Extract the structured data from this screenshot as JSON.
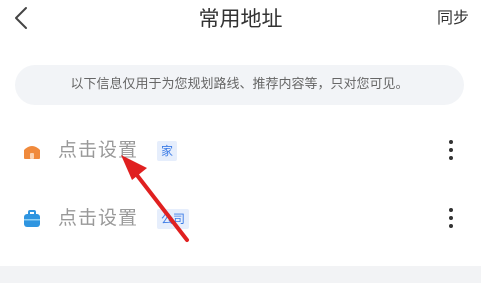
{
  "header": {
    "back_icon": "chevron-left",
    "title": "常用地址",
    "sync_label": "同步"
  },
  "notice": {
    "text": "以下信息仅用于为您规划路线、推荐内容等，只对您可见。"
  },
  "addresses": [
    {
      "icon": "home-icon",
      "icon_color": "#f08a3c",
      "label": "点击设置",
      "tag": "家",
      "more_icon": "more-vertical"
    },
    {
      "icon": "briefcase-icon",
      "icon_color": "#2f95e0",
      "label": "点击设置",
      "tag": "公司",
      "more_icon": "more-vertical"
    }
  ],
  "colors": {
    "annotation_arrow": "#e02020",
    "tag_text": "#3d7ce6",
    "tag_bg": "#e6eefc"
  }
}
